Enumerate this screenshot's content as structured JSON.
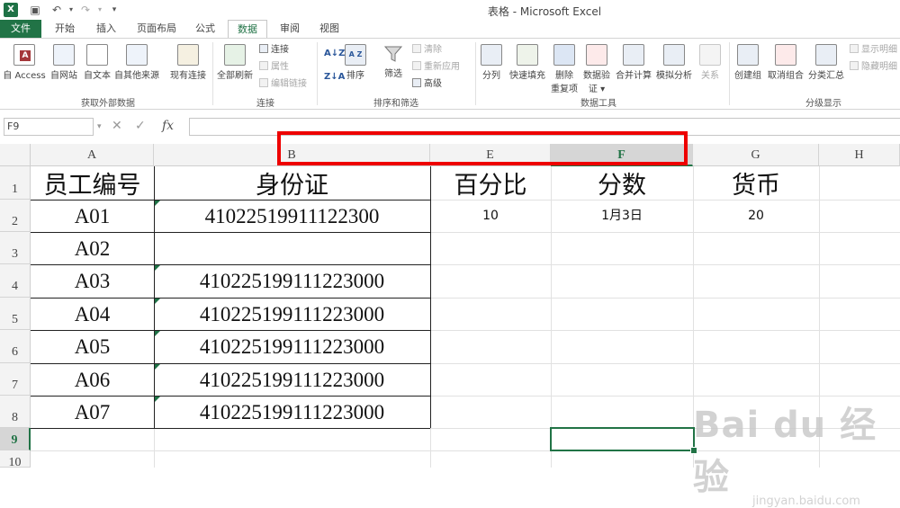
{
  "window": {
    "title": "表格 - Microsoft Excel",
    "logo": "X",
    "quick_access": [
      "save-icon",
      "undo-icon",
      "redo-icon",
      "customize-icon"
    ]
  },
  "tabs": [
    {
      "label": "文件"
    },
    {
      "label": "开始"
    },
    {
      "label": "插入"
    },
    {
      "label": "页面布局"
    },
    {
      "label": "公式"
    },
    {
      "label": "数据"
    },
    {
      "label": "审阅"
    },
    {
      "label": "视图"
    }
  ],
  "ribbon": {
    "groups": {
      "external": "获取外部数据",
      "connections": "连接",
      "sort_filter": "排序和筛选",
      "data_tools": "数据工具",
      "outline": "分级显示"
    },
    "buttons": {
      "from_access": "自 Access",
      "from_web": "自网站",
      "from_text": "自文本",
      "from_other": "自其他来源",
      "existing_conn": "现有连接",
      "refresh_all": "全部刷新",
      "connections": "连接",
      "properties": "属性",
      "edit_links": "编辑链接",
      "sort": "排序",
      "filter": "筛选",
      "clear": "清除",
      "reapply": "重新应用",
      "advanced": "高级",
      "text_to_cols": "分列",
      "flash_fill": "快速填充",
      "remove_dup_1": "删除",
      "remove_dup_2": "重复项",
      "validation_1": "数据验",
      "validation_2": "证 ▾",
      "consolidate": "合并计算",
      "what_if": "模拟分析",
      "relationships": "关系",
      "group": "创建组",
      "ungroup": "取消组合",
      "subtotal": "分类汇总",
      "show_detail": "显示明细",
      "hide_detail": "隐藏明细"
    },
    "sort_icons": {
      "az": "A↓Z",
      "za": "Z↓A",
      "az_big": "A Z"
    }
  },
  "formula_bar": {
    "name_box": "F9",
    "cancel": "✕",
    "enter": "✓",
    "fx": "fx",
    "content": ""
  },
  "sheet": {
    "columns": [
      "A",
      "B",
      "E",
      "F",
      "G",
      "H"
    ],
    "rows": [
      "1",
      "2",
      "3",
      "4",
      "5",
      "6",
      "7",
      "8",
      "9",
      "10"
    ],
    "cells": {
      "A1": "员工编号",
      "B1": "身份证",
      "E1": "百分比",
      "F1": "分数",
      "G1": "货币",
      "A2": "A01",
      "B2": "41022519911122300",
      "E2": "10",
      "F2": "1月3日",
      "G2": "20",
      "A3": "A02",
      "B3": "",
      "A4": "A03",
      "B4": "410225199111223000",
      "A5": "A04",
      "B5": "410225199111223000",
      "A6": "A05",
      "B6": "410225199111223000",
      "A7": "A06",
      "B7": "410225199111223000",
      "A8": "A07",
      "B8": "410225199111223000"
    }
  },
  "watermark": {
    "main": "Bai du 经验",
    "sub": "jingyan.baidu.com"
  },
  "colors": {
    "excel_green": "#217346",
    "highlight_red": "#ee0000"
  }
}
